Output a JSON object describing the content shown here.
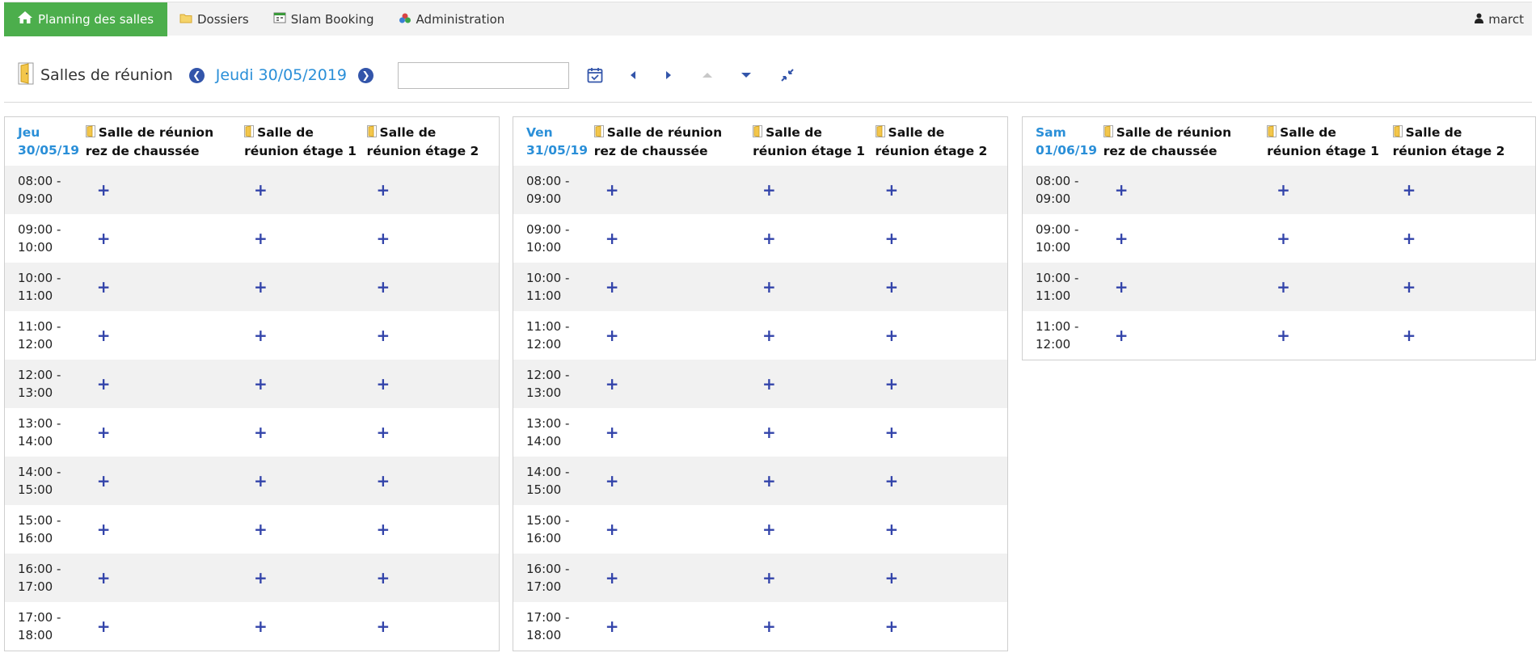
{
  "nav": {
    "items": [
      {
        "label": "Planning des salles",
        "icon": "home-icon"
      },
      {
        "label": "Dossiers",
        "icon": "folder-icon"
      },
      {
        "label": "Slam Booking",
        "icon": "calendar-app-icon"
      },
      {
        "label": "Administration",
        "icon": "admin-icon"
      }
    ],
    "user": "marct"
  },
  "toolbar": {
    "title": "Salles de réunion",
    "date": "Jeudi 30/05/2019",
    "date_input_value": ""
  },
  "days": [
    {
      "day": "Jeu",
      "date": "30/05/19",
      "rooms": [
        {
          "line1": "Salle de réunion",
          "line2": "rez de chaussée"
        },
        {
          "line1": "Salle de",
          "line2": "réunion étage 1"
        },
        {
          "line1": "Salle de",
          "line2": "réunion étage 2"
        }
      ],
      "slots": [
        {
          "start": "08:00 -",
          "end": "09:00"
        },
        {
          "start": "09:00 -",
          "end": "10:00"
        },
        {
          "start": "10:00 -",
          "end": "11:00"
        },
        {
          "start": "11:00 -",
          "end": "12:00"
        },
        {
          "start": "12:00 -",
          "end": "13:00"
        },
        {
          "start": "13:00 -",
          "end": "14:00"
        },
        {
          "start": "14:00 -",
          "end": "15:00"
        },
        {
          "start": "15:00 -",
          "end": "16:00"
        },
        {
          "start": "16:00 -",
          "end": "17:00"
        },
        {
          "start": "17:00 -",
          "end": "18:00"
        }
      ]
    },
    {
      "day": "Ven",
      "date": "31/05/19",
      "rooms": [
        {
          "line1": "Salle de réunion",
          "line2": "rez de chaussée"
        },
        {
          "line1": "Salle de",
          "line2": "réunion étage 1"
        },
        {
          "line1": "Salle de",
          "line2": "réunion étage 2"
        }
      ],
      "slots": [
        {
          "start": "08:00 -",
          "end": "09:00"
        },
        {
          "start": "09:00 -",
          "end": "10:00"
        },
        {
          "start": "10:00 -",
          "end": "11:00"
        },
        {
          "start": "11:00 -",
          "end": "12:00"
        },
        {
          "start": "12:00 -",
          "end": "13:00"
        },
        {
          "start": "13:00 -",
          "end": "14:00"
        },
        {
          "start": "14:00 -",
          "end": "15:00"
        },
        {
          "start": "15:00 -",
          "end": "16:00"
        },
        {
          "start": "16:00 -",
          "end": "17:00"
        },
        {
          "start": "17:00 -",
          "end": "18:00"
        }
      ]
    },
    {
      "day": "Sam",
      "date": "01/06/19",
      "rooms": [
        {
          "line1": "Salle de réunion",
          "line2": "rez de chaussée"
        },
        {
          "line1": "Salle de",
          "line2": "réunion étage 1"
        },
        {
          "line1": "Salle de",
          "line2": "réunion étage 2"
        }
      ],
      "slots": [
        {
          "start": "08:00 -",
          "end": "09:00"
        },
        {
          "start": "09:00 -",
          "end": "10:00"
        },
        {
          "start": "10:00 -",
          "end": "11:00"
        },
        {
          "start": "11:00 -",
          "end": "12:00"
        }
      ]
    }
  ],
  "add_symbol": "+",
  "colors": {
    "nav_active": "#4cae4c",
    "link": "#2a8fd8",
    "plus": "#3344aa",
    "row_alt": "#f1f1f1"
  }
}
